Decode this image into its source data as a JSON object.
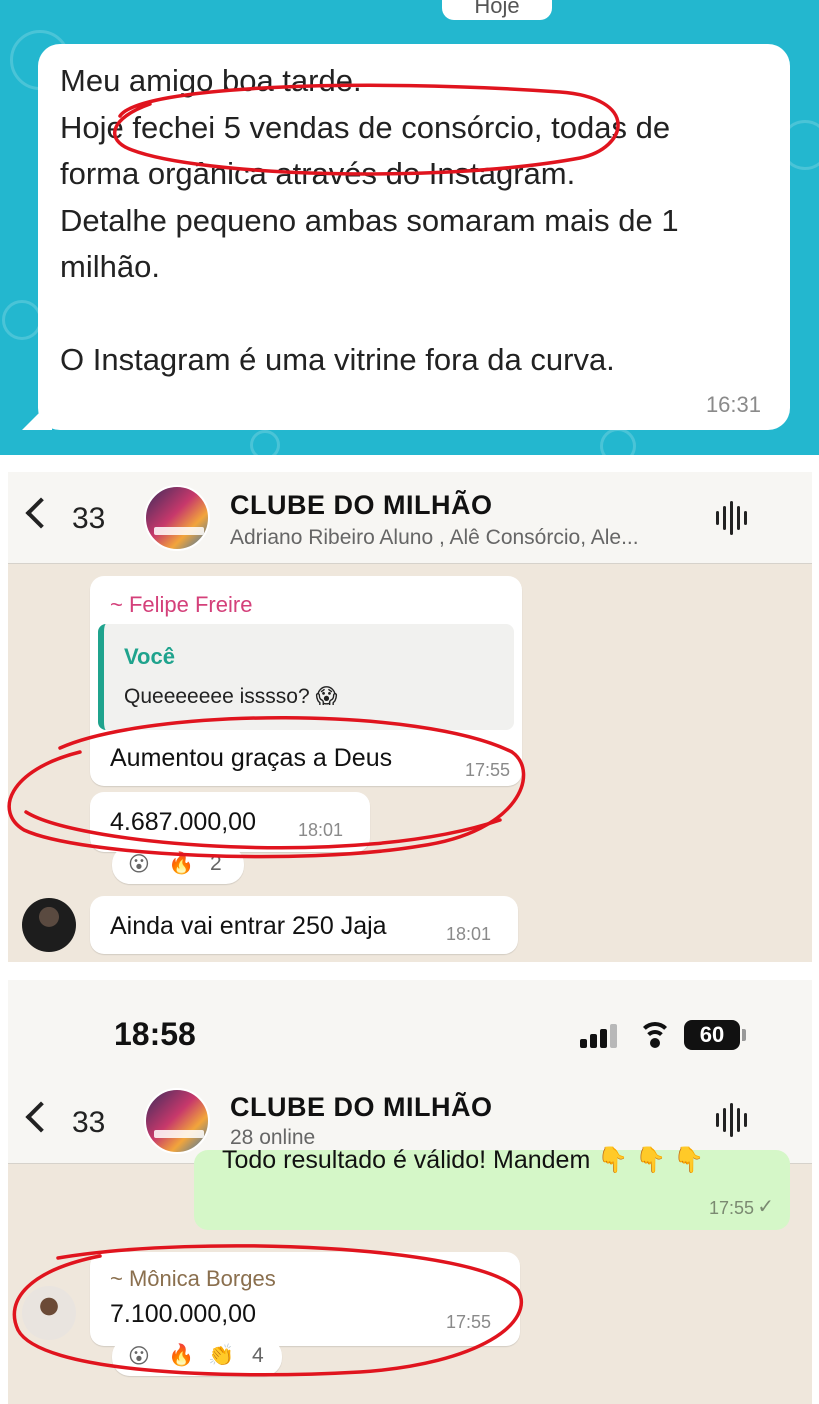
{
  "panel1": {
    "date_chip": "Hoje",
    "message_text": "Meu amigo boa tarde.\nHoje fechei 5 vendas de consórcio, todas de\nforma orgânica através do Instagram.\nDetalhe pequeno ambas somaram mais de 1\nmilhão.\n\nO Instagram é uma vitrine fora da curva.",
    "message_time": "16:31"
  },
  "panel2": {
    "header": {
      "back_count": "33",
      "group_name": "CLUBE DO MILHÃO",
      "group_sub": "Adriano Ribeiro Aluno , Alê Consórcio, Ale..."
    },
    "messages": [
      {
        "sender": "~ Felipe Freire",
        "quote_name": "Você",
        "quote_text": "Queeeeeee isssso? 😱",
        "text": "Aumentou graças a Deus",
        "time": "17:55"
      },
      {
        "text": "4.687.000,00",
        "time": "18:01",
        "reactions": [
          "😮",
          "🔥"
        ],
        "reaction_count": "2"
      },
      {
        "text": "Ainda vai entrar 250 Jaja",
        "time": "18:01"
      }
    ]
  },
  "panel3": {
    "status": {
      "clock": "18:58",
      "battery": "60"
    },
    "header": {
      "back_count": "33",
      "group_name": "CLUBE DO MILHÃO",
      "group_sub": "28 online"
    },
    "outgoing": {
      "text": "Todo resultado é válido! Mandem 👇 👇 👇",
      "time": "17:55",
      "check": "✓"
    },
    "incoming": {
      "sender": "~ Mônica Borges",
      "text": "7.100.000,00",
      "time": "17:55",
      "reactions": [
        "😮",
        "🔥",
        "👏"
      ],
      "reaction_count": "4"
    }
  },
  "colors": {
    "panel1_bg": "#23b7cf",
    "chat_bg": "#efe7dc",
    "annotation_red": "#e0141e",
    "sender_felipe": "#d4407a",
    "sender_monica": "#8a6f4e",
    "quote_accent": "#1fa38d",
    "outgoing_bubble": "#d5f7c8"
  }
}
